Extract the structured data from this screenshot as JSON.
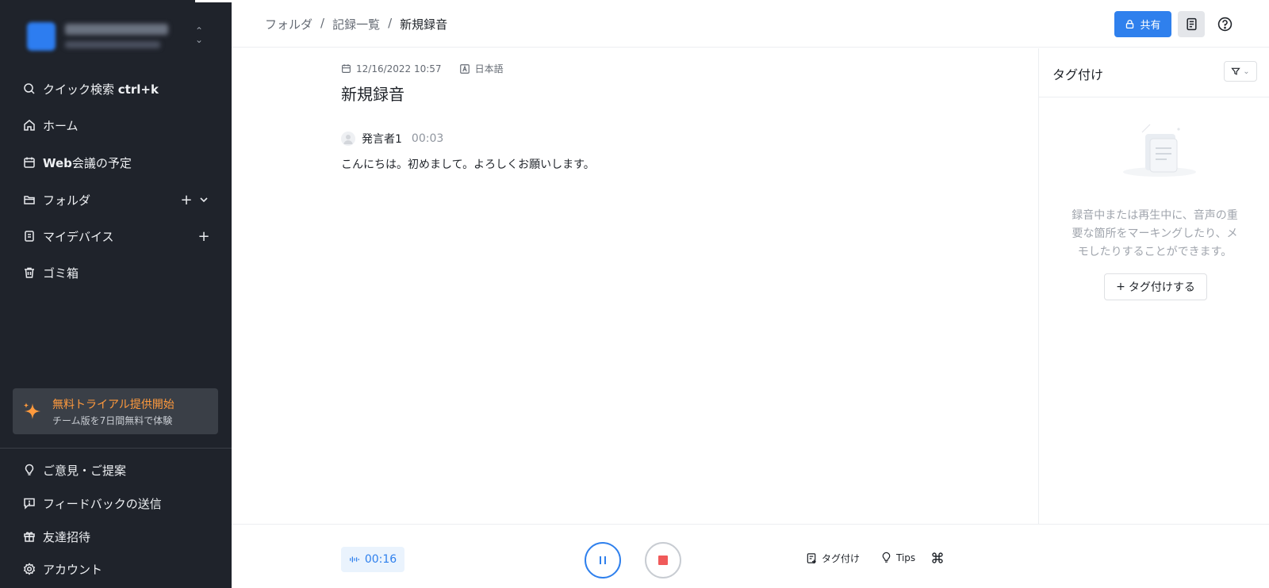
{
  "sidebar": {
    "nav": [
      {
        "label_prefix": "クイック検索 ",
        "label_strong": "ctrl+k",
        "icon": "search-icon"
      },
      {
        "label": "ホーム",
        "icon": "home-icon"
      },
      {
        "label_strong": "Web",
        "label": "会議の予定",
        "icon": "calendar-icon"
      },
      {
        "label": "フォルダ",
        "icon": "folder-icon"
      },
      {
        "label": "マイデバイス",
        "icon": "device-icon"
      },
      {
        "label": "ゴミ箱",
        "icon": "trash-icon"
      }
    ],
    "promo": {
      "title": "無料トライアル提供開始",
      "subtitle": "チーム版を7日間無料で体験"
    },
    "bottom": [
      {
        "label": "ご意見・ご提案",
        "icon": "lightbulb-icon"
      },
      {
        "label": "フィードバックの送信",
        "icon": "feedback-icon"
      },
      {
        "label": "友達招待",
        "icon": "gift-icon"
      },
      {
        "label": "アカウント",
        "icon": "gear-icon"
      }
    ]
  },
  "header": {
    "breadcrumb": [
      "フォルダ",
      "記録一覧",
      "新規録音"
    ],
    "share_label": "共有"
  },
  "recording": {
    "datetime": "12/16/2022 10:57",
    "language": "日本語",
    "title": "新規録音",
    "speaker": "発言者1",
    "speaker_time": "00:03",
    "text": "こんにちは。初めまして。よろしくお願いします。"
  },
  "tags_panel": {
    "title": "タグ付け",
    "empty_line1": "録音中または再生中に、音声の重",
    "empty_line2": "要な箇所をマーキングしたり、メ",
    "empty_line3": "モしたりすることができます。",
    "add_label": "タグ付けする"
  },
  "player": {
    "elapsed": "00:16",
    "tag_label": "タグ付け",
    "tips_label": "Tips"
  },
  "colors": {
    "accent": "#2f80ed",
    "sidebar_bg": "#1f232b",
    "promo_title": "#ff9a3d",
    "stop": "#f05a5a"
  }
}
